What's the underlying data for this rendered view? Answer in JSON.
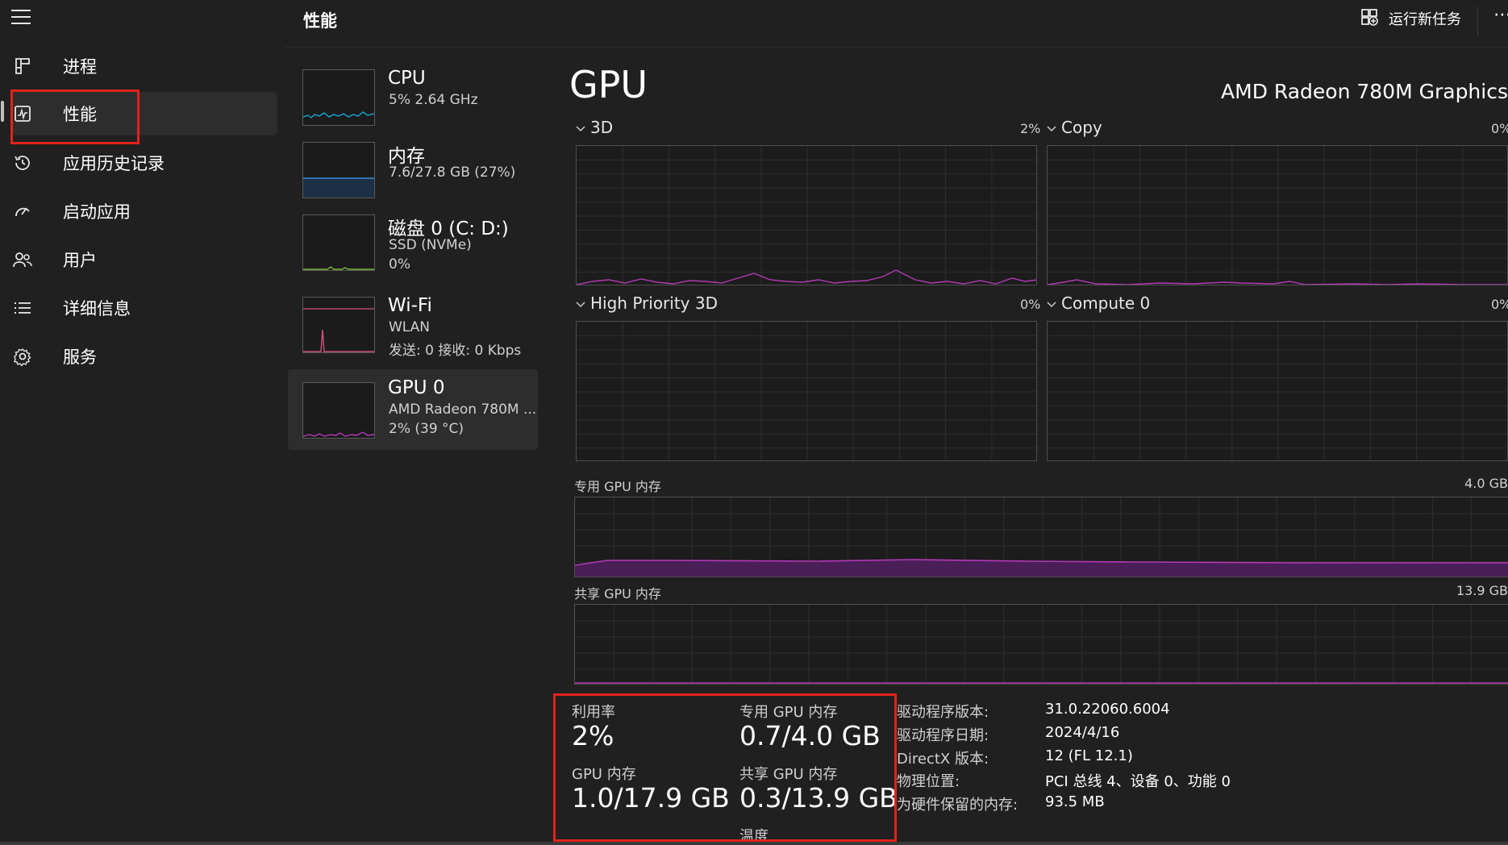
{
  "header": {
    "title": "性能",
    "run_task_label": "运行新任务",
    "more_label": "⋯"
  },
  "nav": {
    "items": [
      {
        "label": "进程",
        "icon": "processes-icon"
      },
      {
        "label": "性能",
        "icon": "performance-icon",
        "selected": true
      },
      {
        "label": "应用历史记录",
        "icon": "app-history-icon"
      },
      {
        "label": "启动应用",
        "icon": "startup-apps-icon"
      },
      {
        "label": "用户",
        "icon": "users-icon"
      },
      {
        "label": "详细信息",
        "icon": "details-icon"
      },
      {
        "label": "服务",
        "icon": "services-icon"
      }
    ]
  },
  "perf_list": [
    {
      "name": "CPU",
      "line1": "5%  2.64 GHz",
      "color": "#17a8d3"
    },
    {
      "name": "内存",
      "line1": "7.6/27.8 GB (27%)",
      "color": "#3b8ad6"
    },
    {
      "name": "磁盘 0 (C: D:)",
      "line1": "SSD (NVMe)",
      "line2": "0%",
      "color": "#7fb83b"
    },
    {
      "name": "Wi-Fi",
      "line1": "WLAN",
      "line2": "发送: 0 接收: 0 Kbps",
      "color": "#d2507f"
    },
    {
      "name": "GPU 0",
      "line1": "AMD Radeon 780M ...",
      "line2": "2% (39 °C)",
      "color": "#b23ab6",
      "selected": true
    }
  ],
  "main": {
    "title": "GPU",
    "model": "AMD Radeon 780M Graphics",
    "engines": [
      {
        "name": "3D",
        "percent": "2%"
      },
      {
        "name": "Copy",
        "percent": "0%"
      },
      {
        "name": "High Priority 3D",
        "percent": "0%"
      },
      {
        "name": "Compute 0",
        "percent": "0%"
      }
    ],
    "dedicated_memory": {
      "label": "专用 GPU 内存",
      "max": "4.0 GB"
    },
    "shared_memory": {
      "label": "共享 GPU 内存",
      "max": "13.9 GB"
    }
  },
  "stats": {
    "utilization_label": "利用率",
    "utilization_value": "2%",
    "dedicated_label": "专用 GPU 内存",
    "dedicated_value": "0.7/4.0 GB",
    "gpu_memory_label": "GPU 内存",
    "gpu_memory_value": "1.0/17.9 GB",
    "shared_label": "共享 GPU 内存",
    "shared_value": "0.3/13.9 GB",
    "temperature_label": "温度"
  },
  "properties": [
    {
      "key": "驱动程序版本:",
      "value": "31.0.22060.6004"
    },
    {
      "key": "驱动程序日期:",
      "value": "2024/4/16"
    },
    {
      "key": "DirectX 版本:",
      "value": "12 (FL 12.1)"
    },
    {
      "key": "物理位置:",
      "value": "PCI 总线 4、设备 0、功能 0"
    },
    {
      "key": "为硬件保留的内存:",
      "value": "93.5 MB"
    }
  ],
  "colors": {
    "gpu_accent": "#b23ab6",
    "highlight": "#e2231a"
  }
}
